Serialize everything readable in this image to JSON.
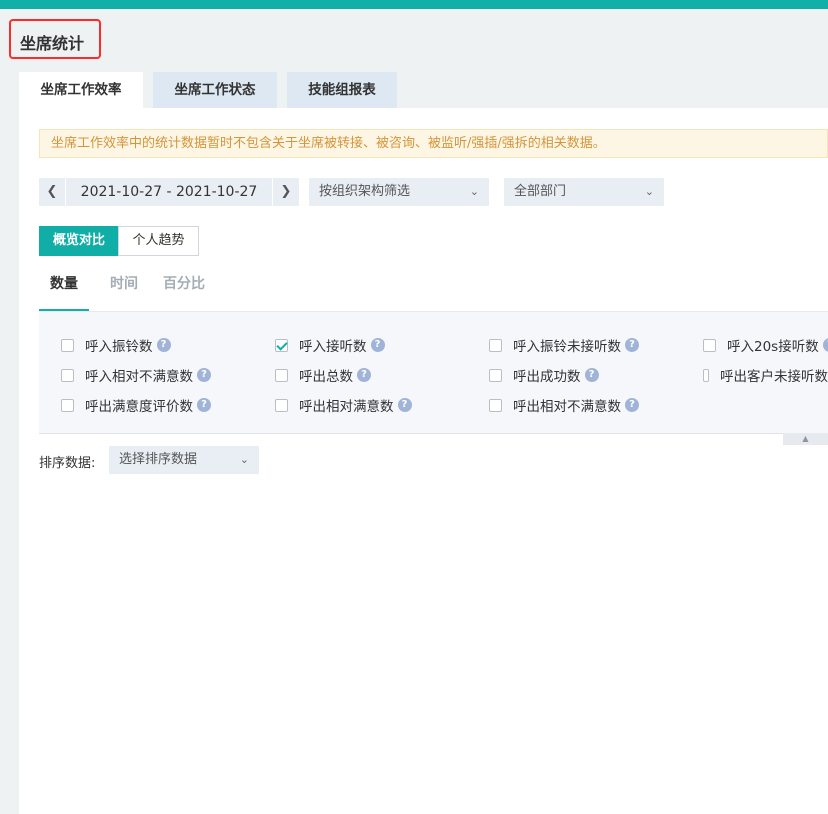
{
  "page_title": "坐席统计",
  "tabs": [
    {
      "label": "坐席工作效率",
      "active": true
    },
    {
      "label": "坐席工作状态",
      "active": false
    },
    {
      "label": "技能组报表",
      "active": false
    }
  ],
  "notice": "坐席工作效率中的统计数据暂时不包含关于坐席被转接、被咨询、被监听/强插/强拆的相关数据。",
  "filters": {
    "date_range": "2021-10-27 - 2021-10-27",
    "org_filter": "按组织架构筛选",
    "dept_filter": "全部部门"
  },
  "view_mode": {
    "overview_label": "概览对比",
    "trend_label": "个人趋势"
  },
  "sub_tabs": [
    "数量",
    "时间",
    "百分比"
  ],
  "metrics": [
    {
      "label": "呼入振铃数",
      "checked": false
    },
    {
      "label": "呼入接听数",
      "checked": true
    },
    {
      "label": "呼入振铃未接听数",
      "checked": false
    },
    {
      "label": "呼入20s接听数",
      "checked": false
    },
    {
      "label": "呼入相对不满意数",
      "checked": false
    },
    {
      "label": "呼出总数",
      "checked": false
    },
    {
      "label": "呼出成功数",
      "checked": false
    },
    {
      "label": "呼出客户未接听数",
      "checked": false
    },
    {
      "label": "呼出满意度评价数",
      "checked": false
    },
    {
      "label": "呼出相对满意数",
      "checked": false
    },
    {
      "label": "呼出相对不满意数",
      "checked": false
    }
  ],
  "help_glyph": "?",
  "sort": {
    "label": "排序数据:",
    "placeholder": "选择排序数据"
  },
  "icons": {
    "prev": "chevron-left-icon",
    "next": "chevron-right-icon",
    "dropdown": "chevron-down-icon",
    "collapse": "chevron-up-icon"
  },
  "colors": {
    "accent": "#10b0a8",
    "highlight_border": "#ff2a2a",
    "notice_text": "#d4953a",
    "notice_bg": "#fdf6e4",
    "help_icon": "#9fb4d6"
  }
}
